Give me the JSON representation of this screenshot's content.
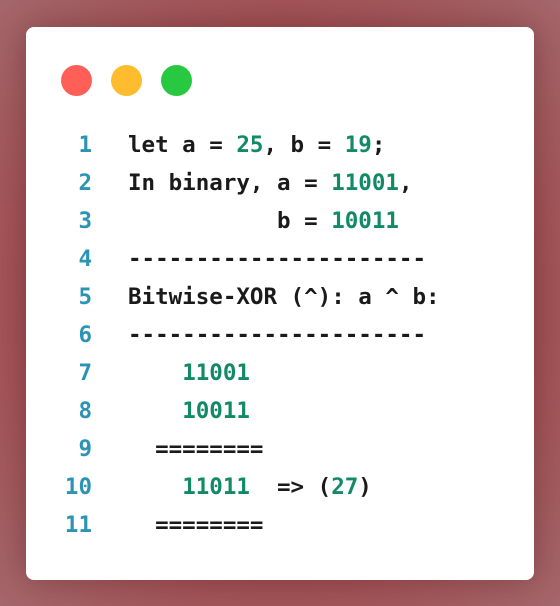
{
  "window_controls": [
    {
      "name": "close",
      "color": "#ff5f57"
    },
    {
      "name": "minimize",
      "color": "#febc2e"
    },
    {
      "name": "maximize",
      "color": "#28c840"
    }
  ],
  "colors": {
    "line_number": "#2b93b4",
    "number_literal": "#128a65",
    "text": "#1a1a1a"
  },
  "lines": [
    {
      "n": "1",
      "segments": [
        {
          "t": "let a = ",
          "k": "txt"
        },
        {
          "t": "25",
          "k": "num"
        },
        {
          "t": ", b = ",
          "k": "txt"
        },
        {
          "t": "19",
          "k": "num"
        },
        {
          "t": ";",
          "k": "txt"
        }
      ]
    },
    {
      "n": "2",
      "segments": [
        {
          "t": "In binary, a = ",
          "k": "txt"
        },
        {
          "t": "11001",
          "k": "num"
        },
        {
          "t": ",",
          "k": "txt"
        }
      ]
    },
    {
      "n": "3",
      "segments": [
        {
          "t": "           b = ",
          "k": "txt"
        },
        {
          "t": "10011",
          "k": "num"
        }
      ]
    },
    {
      "n": "4",
      "segments": [
        {
          "t": "----------------------",
          "k": "txt"
        }
      ]
    },
    {
      "n": "5",
      "segments": [
        {
          "t": "Bitwise-XOR (^): a ^ b:",
          "k": "txt"
        }
      ]
    },
    {
      "n": "6",
      "segments": [
        {
          "t": "----------------------",
          "k": "txt"
        }
      ]
    },
    {
      "n": "7",
      "segments": [
        {
          "t": "    ",
          "k": "txt"
        },
        {
          "t": "11001",
          "k": "num"
        }
      ]
    },
    {
      "n": "8",
      "segments": [
        {
          "t": "    ",
          "k": "txt"
        },
        {
          "t": "10011",
          "k": "num"
        }
      ]
    },
    {
      "n": "9",
      "segments": [
        {
          "t": "  ========",
          "k": "txt"
        }
      ]
    },
    {
      "n": "10",
      "segments": [
        {
          "t": "    ",
          "k": "txt"
        },
        {
          "t": "11011",
          "k": "num"
        },
        {
          "t": "  => (",
          "k": "txt"
        },
        {
          "t": "27",
          "k": "num"
        },
        {
          "t": ")",
          "k": "txt"
        }
      ]
    },
    {
      "n": "11",
      "segments": [
        {
          "t": "  ========",
          "k": "txt"
        }
      ]
    }
  ]
}
